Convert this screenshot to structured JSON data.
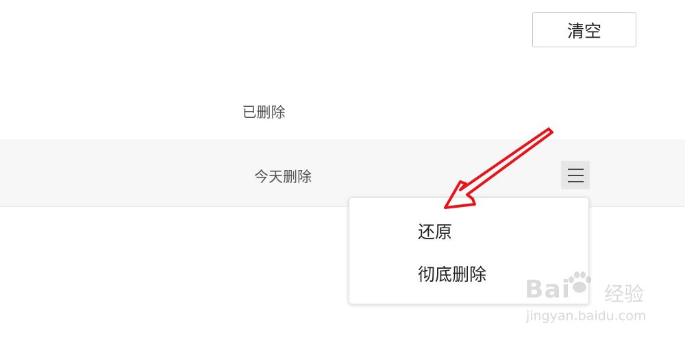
{
  "toolbar": {
    "clear_label": "清空"
  },
  "list": {
    "column_header": "已删除",
    "rows": [
      {
        "label": "今天删除",
        "menu_icon": "hamburger-menu-icon"
      }
    ]
  },
  "context_menu": {
    "items": [
      {
        "label": "还原"
      },
      {
        "label": "彻底删除"
      }
    ]
  },
  "annotation": {
    "arrow_color": "#e8141b"
  },
  "watermark": {
    "brand_text": "Bai",
    "brand_suffix": "经验",
    "domain": "jingyan.baidu.com"
  }
}
